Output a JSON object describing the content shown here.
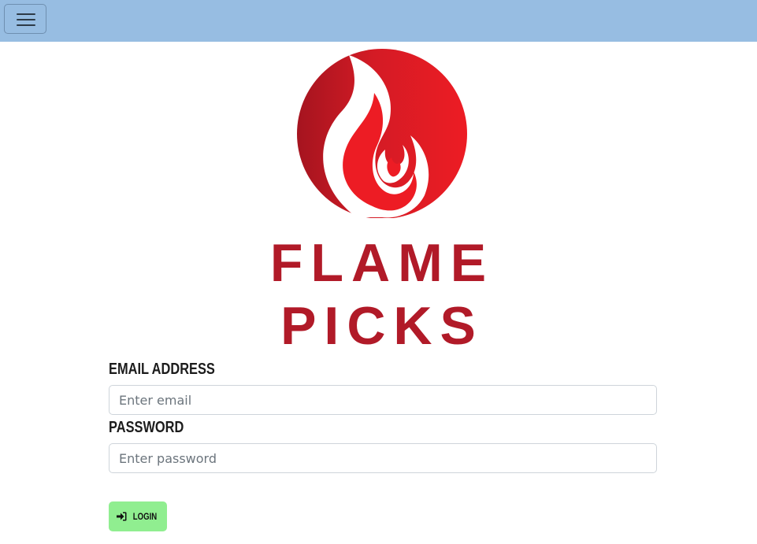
{
  "navbar": {
    "toggle_icon": "hamburger-menu-icon",
    "background": "#97bde2"
  },
  "logo": {
    "icon": "flame-icon",
    "line1": "FLAME",
    "line2": "PICKS",
    "brand_color": "#b11a28",
    "accent_color": "#ed1c24"
  },
  "form": {
    "email_label": "EMAIL ADDRESS",
    "email_placeholder": "Enter email",
    "email_value": "",
    "password_label": "PASSWORD",
    "password_placeholder": "Enter password",
    "password_value": "",
    "login_label": "LOGIN",
    "login_icon": "sign-in-icon",
    "login_color": "#90ee90"
  }
}
